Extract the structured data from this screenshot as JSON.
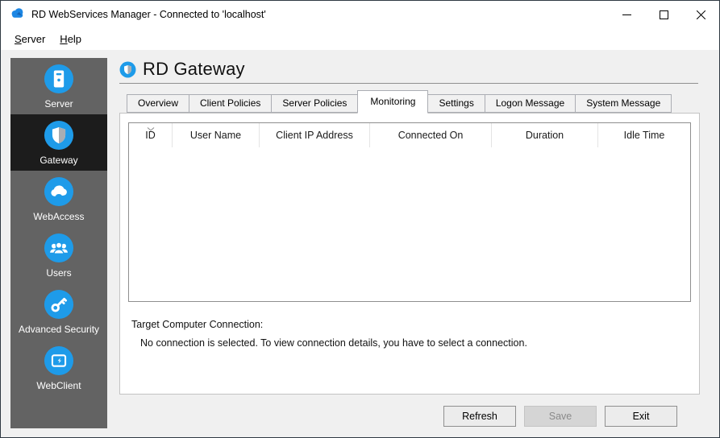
{
  "window": {
    "title": "RD WebServices Manager - Connected to 'localhost'"
  },
  "menu": {
    "items": [
      {
        "label": "Server"
      },
      {
        "label": "Help"
      }
    ]
  },
  "sidebar": {
    "selected": "Gateway",
    "items": [
      {
        "label": "Server",
        "icon": "server-icon"
      },
      {
        "label": "Gateway",
        "icon": "shield-icon"
      },
      {
        "label": "WebAccess",
        "icon": "cloud-icon"
      },
      {
        "label": "Users",
        "icon": "users-icon"
      },
      {
        "label": "Advanced Security",
        "icon": "key-icon"
      },
      {
        "label": "WebClient",
        "icon": "monitor-icon"
      }
    ]
  },
  "main": {
    "page_title": "RD Gateway",
    "active_tab": "Monitoring",
    "tabs": [
      {
        "label": "Overview"
      },
      {
        "label": "Client Policies"
      },
      {
        "label": "Server Policies"
      },
      {
        "label": "Monitoring"
      },
      {
        "label": "Settings"
      },
      {
        "label": "Logon Message"
      },
      {
        "label": "System Message"
      }
    ],
    "connections_table": {
      "columns": [
        "ID",
        "User Name",
        "Client IP Address",
        "Connected On",
        "Duration",
        "Idle Time"
      ],
      "sorted_column": "ID",
      "rows": []
    },
    "target_connection": {
      "label": "Target Computer Connection:",
      "message": "No connection is selected. To view connection details, you have to select a connection."
    },
    "footer_buttons": [
      {
        "label": "Refresh",
        "enabled": true
      },
      {
        "label": "Save",
        "enabled": false
      },
      {
        "label": "Exit",
        "enabled": true
      }
    ]
  },
  "colors": {
    "accent_blue": "#1e9be9",
    "sidebar_gray": "#636363",
    "sidebar_selected": "#1c1c1c",
    "window_bg": "#f0f0f0"
  }
}
